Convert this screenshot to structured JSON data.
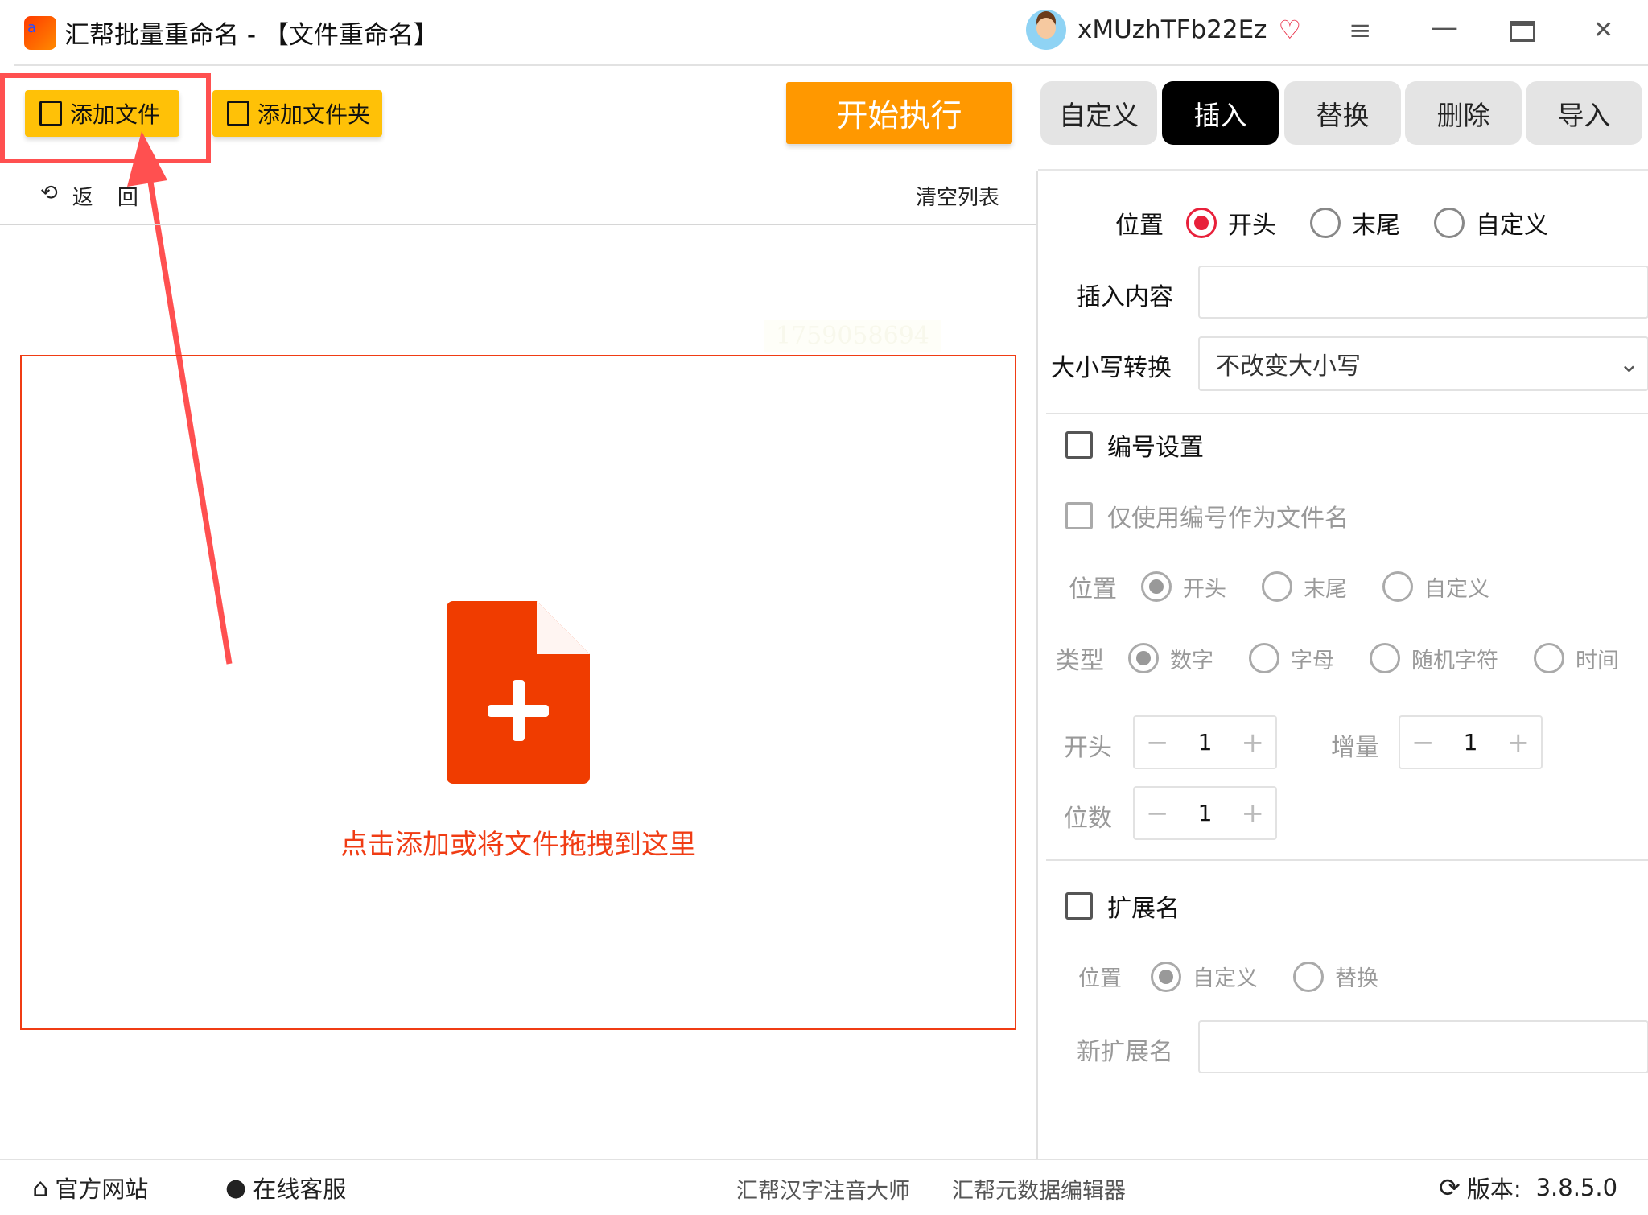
{
  "window": {
    "title": "汇帮批量重命名 - 【文件重命名】",
    "username": "xMUzhTFb22Ez",
    "logo_text": "a"
  },
  "toolbar": {
    "add_file": "添加文件",
    "add_folder": "添加文件夹",
    "start": "开始执行",
    "back": "返",
    "back2": "回",
    "clear_list": "清空列表"
  },
  "tabs": [
    {
      "label": "自定义"
    },
    {
      "label": "插入",
      "active": true
    },
    {
      "label": "替换"
    },
    {
      "label": "删除"
    },
    {
      "label": "导入"
    }
  ],
  "dropzone": {
    "text": "点击添加或将文件拖拽到这里",
    "watermark": "1759058694"
  },
  "insert": {
    "position_label": "位置",
    "positions": [
      "开头",
      "末尾",
      "自定义"
    ],
    "content_label": "插入内容",
    "content_value": "",
    "case_label": "大小写转换",
    "case_value": "不改变大小写"
  },
  "numbering": {
    "label": "编号设置",
    "only_number": "仅使用编号作为文件名",
    "position_label": "位置",
    "positions": [
      "开头",
      "末尾",
      "自定义"
    ],
    "type_label": "类型",
    "types": [
      "数字",
      "字母",
      "随机字符",
      "时间"
    ],
    "start_label": "开头",
    "start_value": "1",
    "increment_label": "增量",
    "increment_value": "1",
    "digits_label": "位数",
    "digits_value": "1"
  },
  "extension": {
    "label": "扩展名",
    "position_label": "位置",
    "positions": [
      "自定义",
      "替换"
    ],
    "new_label": "新扩展名",
    "new_value": ""
  },
  "footer": {
    "website": "官方网站",
    "support": "在线客服",
    "link1": "汇帮汉字注音大师",
    "link2": "汇帮元数据编辑器",
    "version_label": "版本:",
    "version": "3.8.5.0"
  },
  "colors": {
    "accent": "#e8203a",
    "yellow": "#ffc107",
    "orange": "#ff9800",
    "drop": "#f03c14"
  }
}
